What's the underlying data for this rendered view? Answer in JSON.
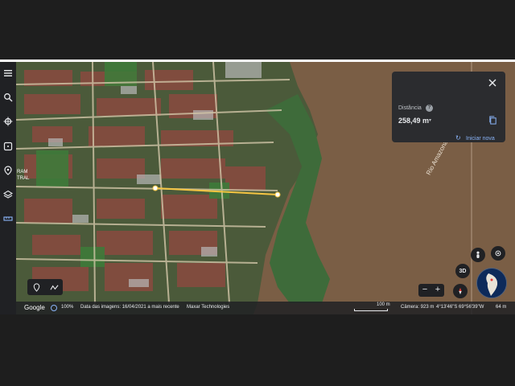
{
  "map": {
    "river_label": "Rio Amazonas",
    "city_label_line1": "RAM",
    "city_label_line2": "TRAL"
  },
  "left_rail": {
    "items": [
      {
        "name": "menu-icon"
      },
      {
        "name": "search-icon"
      },
      {
        "name": "voyager-icon"
      },
      {
        "name": "dice-icon"
      },
      {
        "name": "projects-icon"
      },
      {
        "name": "layers-icon"
      },
      {
        "name": "ruler-icon"
      }
    ]
  },
  "distance_panel": {
    "label": "Distância",
    "help": "?",
    "value": "258,49 m",
    "caret": "▾",
    "restart": "Iniciar nova"
  },
  "controls": {
    "three_d": "3D",
    "zoom_out": "−",
    "zoom_in": "+"
  },
  "bottom_bar": {
    "logo": "Google",
    "zoom_percent": "100%",
    "imagery_date": "Data das imagens: 16/04/2021 a mais recente",
    "provider": "Maxar Technologies",
    "scale": "100 m",
    "camera": "Câmera: 923 m",
    "coordinates": "4°13'46\"S 69°56'39\"W",
    "elevation": "64 m"
  },
  "colors": {
    "river": "#7a5e45",
    "measure_line": "#f5c542",
    "panel_bg": "#2b2c2f",
    "accent_blue": "#8ab4f8"
  }
}
